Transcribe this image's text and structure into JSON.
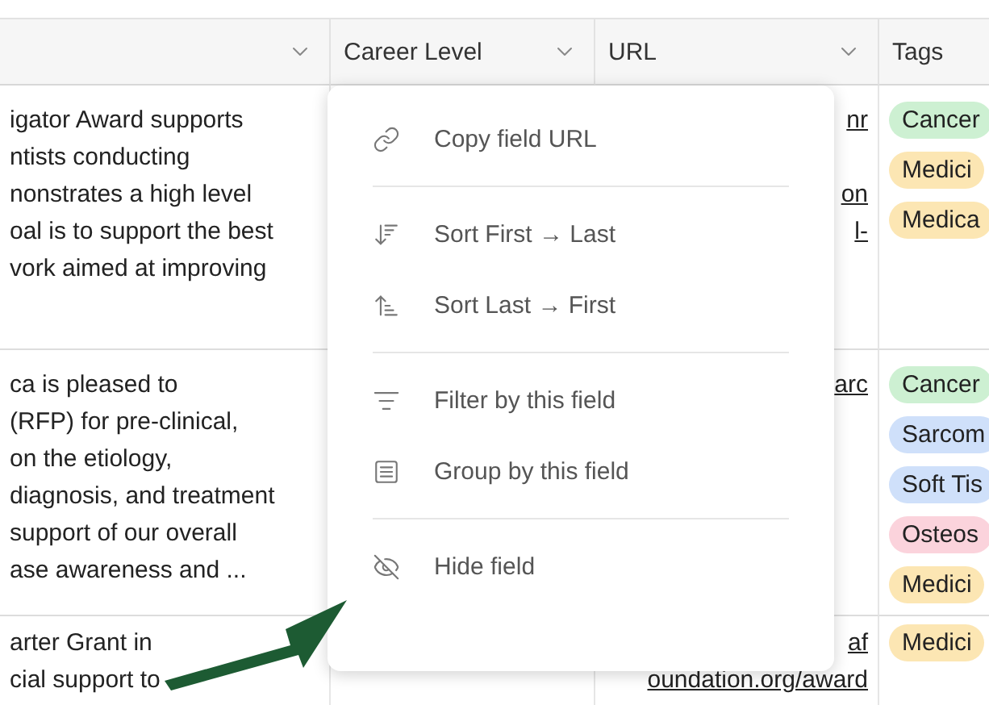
{
  "columns": [
    {},
    {
      "label": "Career Level"
    },
    {
      "label": "URL"
    },
    {
      "label": "Tags"
    }
  ],
  "rows": [
    {
      "description": [
        "igator Award supports",
        "ntists conducting",
        "nonstrates a high level",
        "oal is to support the best",
        "vork aimed at improving"
      ],
      "url": [
        "nr",
        "on",
        "l-"
      ],
      "tags": [
        {
          "label": "Cancer",
          "color": "#cdf0d2"
        },
        {
          "label": "Medici",
          "color": "#fce6b3"
        },
        {
          "label": "Medica",
          "color": "#fce6b3"
        }
      ]
    },
    {
      "description": [
        "ca is pleased to",
        "(RFP) for pre-clinical,",
        "on the etiology,",
        "diagnosis, and treatment",
        "support of our overall",
        "ase awareness and ..."
      ],
      "url": [
        "arc"
      ],
      "tags": [
        {
          "label": "Cancer",
          "color": "#cdf0d2"
        },
        {
          "label": "Sarcom",
          "color": "#cfe0fa"
        },
        {
          "label": "Soft Tis",
          "color": "#cfe0fa"
        },
        {
          "label": "Osteos",
          "color": "#fbd3dc"
        },
        {
          "label": "Medici",
          "color": "#fce6b3"
        }
      ]
    },
    {
      "description": [
        "arter Grant in",
        "cial support to"
      ],
      "url": [
        "af",
        "oundation.org/award"
      ],
      "tags": [
        {
          "label": "Medici",
          "color": "#fce6b3"
        }
      ]
    }
  ],
  "menu": {
    "groups": [
      [
        {
          "kind": "link",
          "label": "Copy field URL"
        }
      ],
      [
        {
          "kind": "sort-down",
          "label": "Sort First → Last"
        },
        {
          "kind": "sort-up",
          "label": "Sort Last → First"
        }
      ],
      [
        {
          "kind": "filter",
          "label": "Filter by this field"
        },
        {
          "kind": "group",
          "label": "Group by this field"
        }
      ],
      [
        {
          "kind": "hide",
          "label": "Hide field"
        }
      ]
    ]
  }
}
